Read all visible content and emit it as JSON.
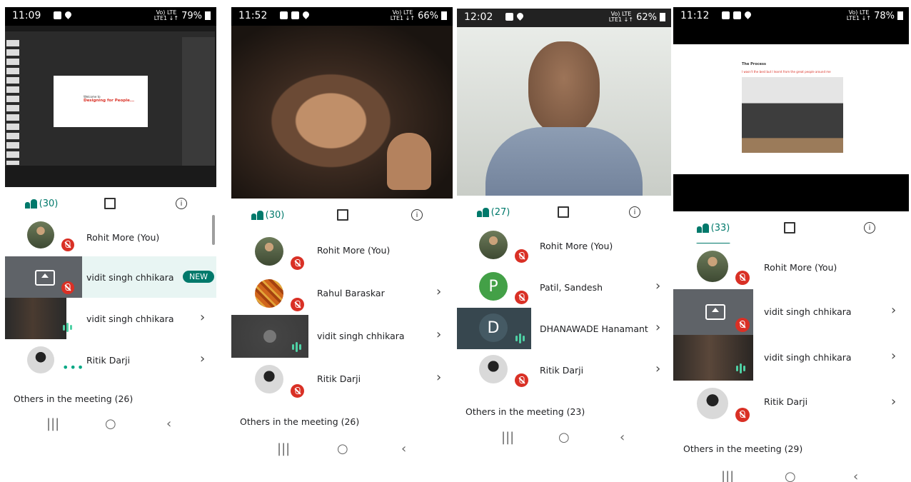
{
  "colors": {
    "accent": "#00796b",
    "mute": "#d93025",
    "speaking": "#4fd1a5",
    "highlight": "#e8f5f3"
  },
  "icons": {
    "people": "people-icon",
    "chat": "chat-icon",
    "info": "info-icon",
    "mic_off": "mic-off-icon",
    "present": "present-screen-icon",
    "chevron": "chevron-right-icon"
  },
  "phones": [
    {
      "status": {
        "time": "11:09",
        "battery": "79%",
        "net_top": "Vo) LTE",
        "net_bottom": "LTE1 ↓↑"
      },
      "slide": {
        "small": "Welcome to",
        "title": "Designing for People..."
      },
      "tabs": {
        "people_count": "(30)"
      },
      "participants": [
        {
          "name": "Rohit More (You)"
        },
        {
          "name": "vidit singh chhikara",
          "badge": "NEW"
        },
        {
          "name": "vidit singh chhikara"
        },
        {
          "name": "Ritik Darji",
          "status": "•••"
        }
      ],
      "others": "Others in the meeting (26)",
      "nav": {
        "recents": "|||",
        "home": "○",
        "back": "‹"
      }
    },
    {
      "status": {
        "time": "11:52",
        "battery": "66%",
        "net_top": "Vo) LTE",
        "net_bottom": "LTE1 ↓↑"
      },
      "tabs": {
        "people_count": "(30)"
      },
      "participants": [
        {
          "name": "Rohit More (You)"
        },
        {
          "name": "Rahul Baraskar"
        },
        {
          "name": "vidit singh chhikara"
        },
        {
          "name": "Ritik Darji"
        }
      ],
      "others": "Others in the meeting (26)",
      "nav": {
        "recents": "|||",
        "home": "○",
        "back": "‹"
      }
    },
    {
      "status": {
        "time": "12:02",
        "battery": "62%",
        "net_top": "Vo) LTE",
        "net_bottom": "LTE1 ↓↑"
      },
      "tabs": {
        "people_count": "(27)"
      },
      "participants": [
        {
          "name": "Rohit More (You)"
        },
        {
          "name": "Patil, Sandesh",
          "initial": "P"
        },
        {
          "name": "DHANAWADE Hanamant",
          "initial": "D"
        },
        {
          "name": "Ritik Darji"
        }
      ],
      "others": "Others in the meeting (23)",
      "nav": {
        "recents": "|||",
        "home": "○",
        "back": "‹"
      }
    },
    {
      "status": {
        "time": "11:12",
        "battery": "78%",
        "net_top": "Vo) LTE",
        "net_bottom": "LTE1 ↓↑"
      },
      "slide": {
        "title": "The Process",
        "subtitle": "I wasn't the best but I learnt from the great people around me"
      },
      "tabs": {
        "people_count": "(33)"
      },
      "participants": [
        {
          "name": "Rohit More (You)"
        },
        {
          "name": "vidit singh chhikara"
        },
        {
          "name": "vidit singh chhikara"
        },
        {
          "name": "Ritik Darji"
        }
      ],
      "others": "Others in the meeting (29)",
      "nav": {
        "recents": "|||",
        "home": "○",
        "back": "‹"
      }
    }
  ]
}
